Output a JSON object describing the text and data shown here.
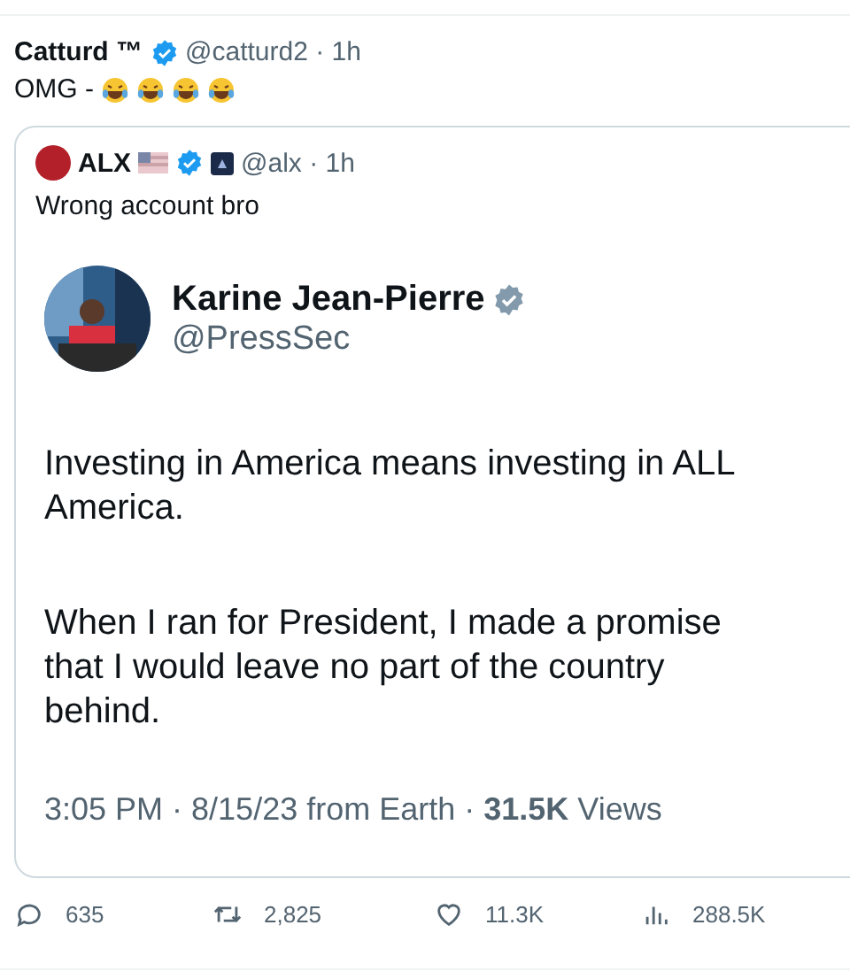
{
  "tweet": {
    "author": "Catturd ™",
    "meta": "@catturd2 · 1h",
    "text": "OMG -",
    "emojis": [
      {
        "kind": "laughing"
      },
      {
        "kind": "laughing"
      },
      {
        "kind": "laughing"
      },
      {
        "kind": "laughing"
      }
    ]
  },
  "quote": {
    "author": "ALX",
    "meta": "@alx · 1h",
    "text": "Wrong account bro",
    "screenshot": {
      "author": "Karine Jean-Pierre",
      "handle": "@PressSec",
      "paragraphs": [
        [
          "Investing in America means investing in ALL",
          "America."
        ],
        [
          "When I ran for President, I made a promise",
          "that I would leave no part of the country",
          "behind."
        ]
      ],
      "footer": "3:05 PM · 8/15/23 from Earth · **31.5K** Views"
    }
  },
  "actions": [
    {
      "kind": "reply",
      "count": "635"
    },
    {
      "kind": "repost",
      "count": "2,825"
    },
    {
      "kind": "like",
      "count": "11.3K"
    },
    {
      "kind": "views",
      "count": "288.5K"
    }
  ]
}
